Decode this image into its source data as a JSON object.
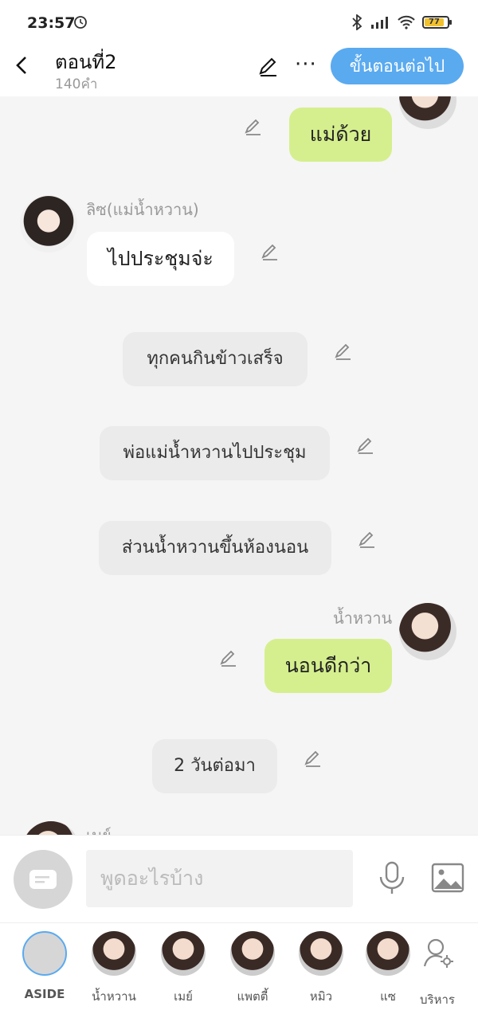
{
  "status": {
    "time": "23:57",
    "battery": "77"
  },
  "header": {
    "title": "ตอนที่2",
    "subtitle": "140คำ",
    "next_label": "ขั้นตอนต่อไป"
  },
  "messages": {
    "m1": "แม่ด้วย",
    "liz_name": "ลิซ(แม่น้ำหวาน)",
    "m2": "ไปประชุมจ่ะ",
    "n1": "ทุกคนกินข้าวเสร็จ",
    "n2": "พ่อแม่น้ำหวานไปประชุม",
    "n3": "ส่วนน้ำหวานขึ้นห้องนอน",
    "namwan_name": "น้ำหวาน",
    "m3": "นอนดีกว่า",
    "n4": "2 วันต่อมา",
    "may_name": "เมย์"
  },
  "input": {
    "placeholder": "พูดอะไรบ้าง"
  },
  "tabs": [
    {
      "label": "ASIDE"
    },
    {
      "label": "น้ำหวาน"
    },
    {
      "label": "เมย์"
    },
    {
      "label": "แพตตี้"
    },
    {
      "label": "หมิว"
    },
    {
      "label": "แซ"
    },
    {
      "label": "บริหาร"
    }
  ]
}
